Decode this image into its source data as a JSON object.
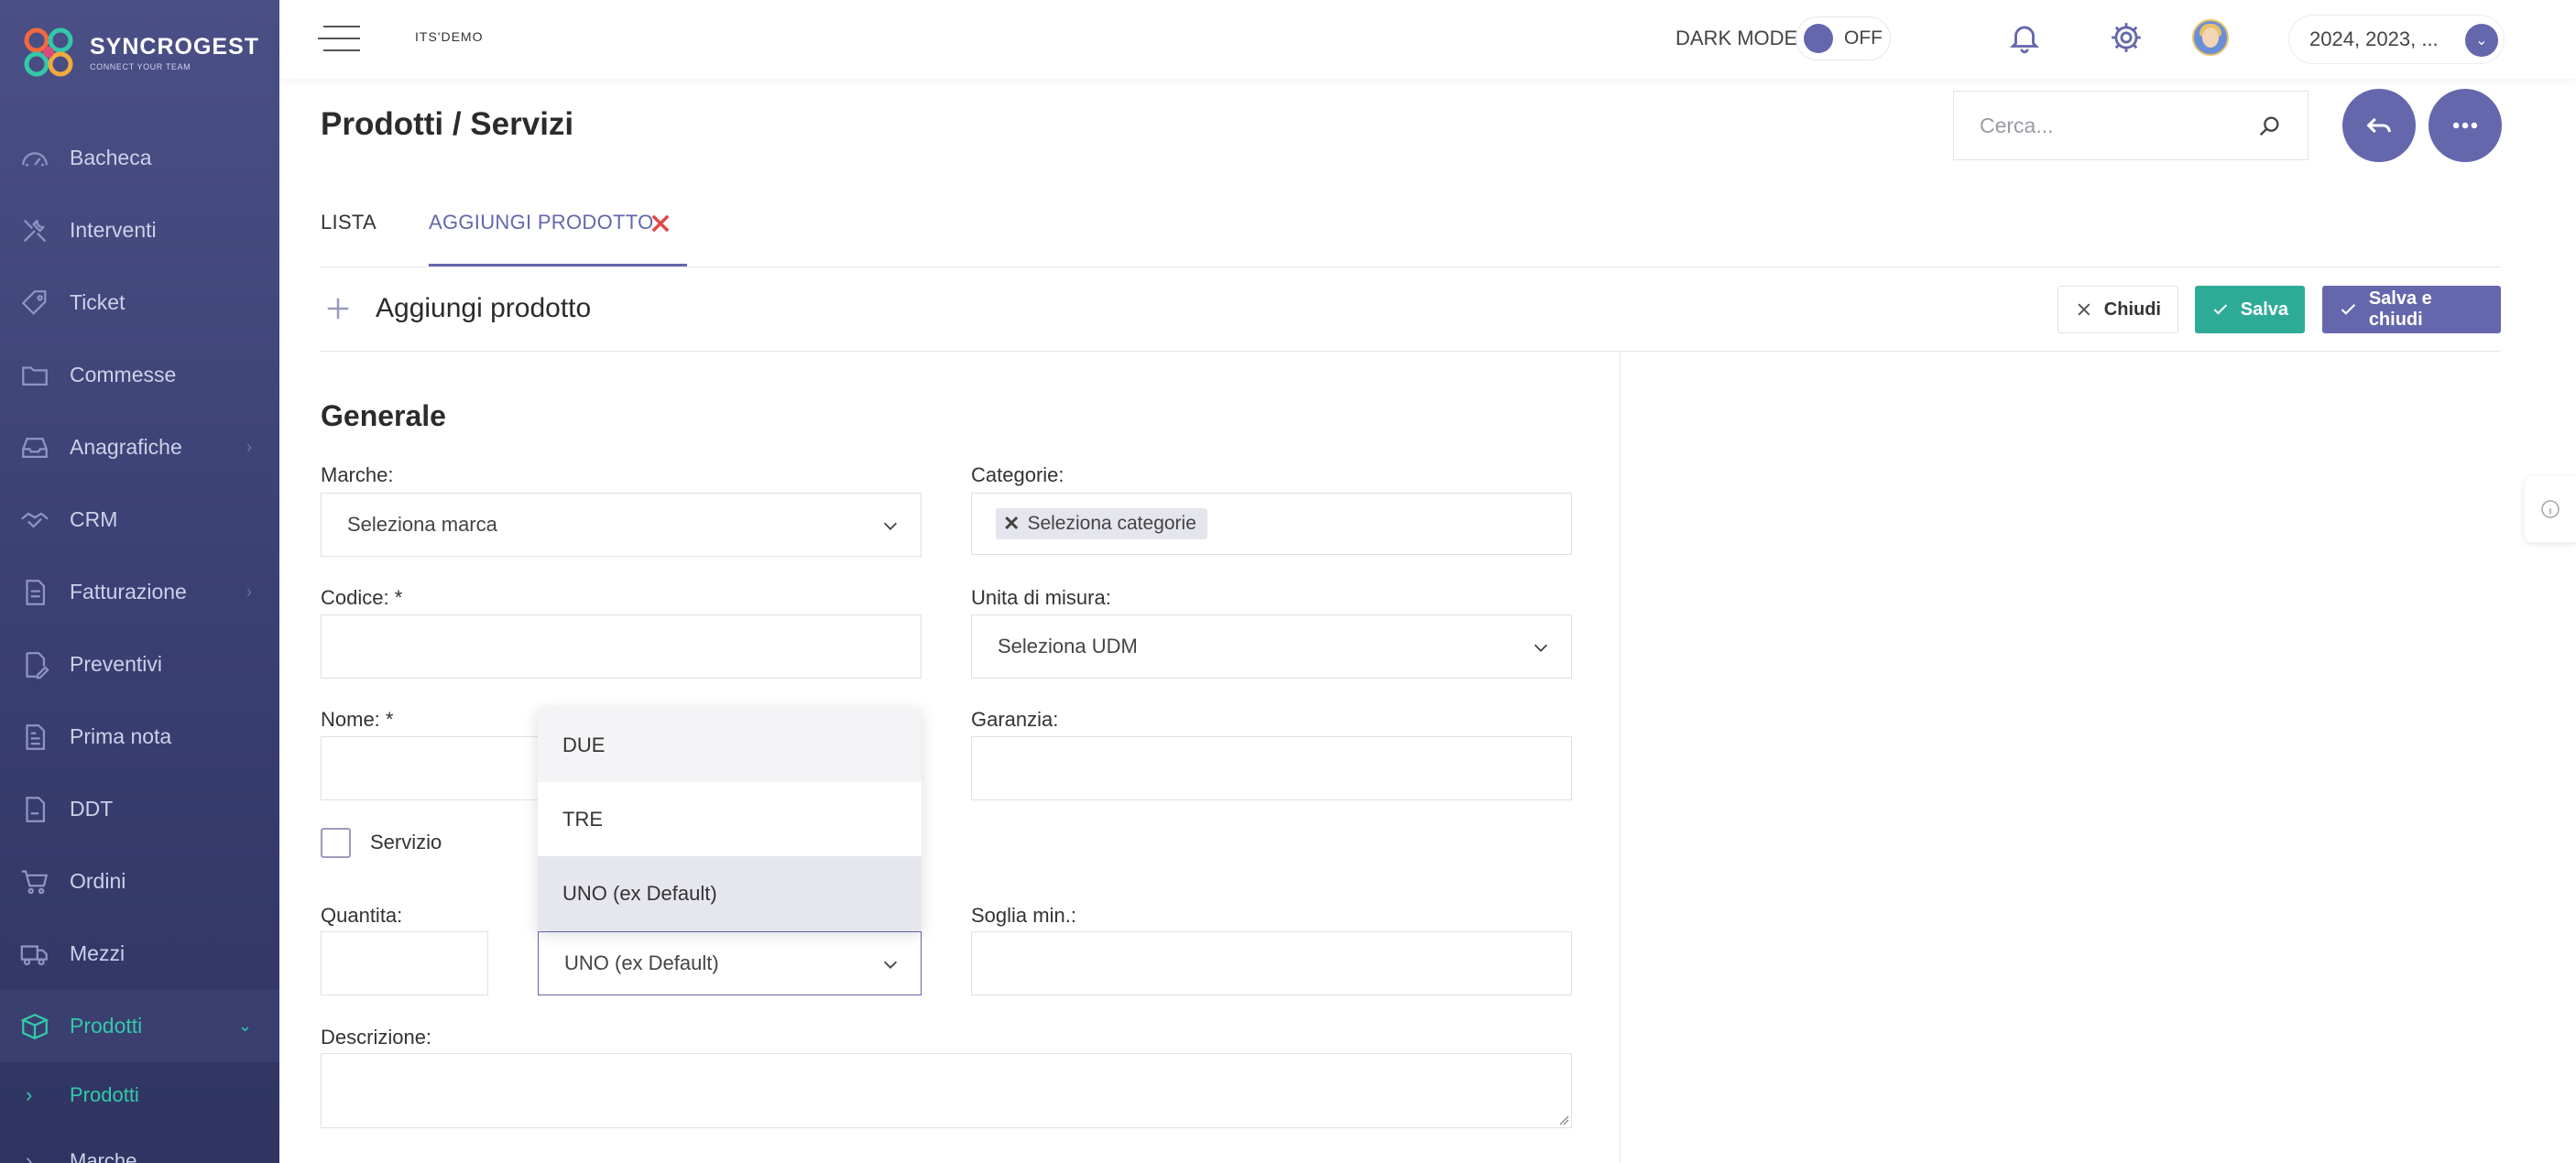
{
  "brand": {
    "name": "SYNCROGEST",
    "tagline": "CONNECT YOUR TEAM"
  },
  "sidebar": {
    "items": [
      {
        "label": "Bacheca",
        "icon": "dashboard-icon"
      },
      {
        "label": "Interventi",
        "icon": "tools-icon"
      },
      {
        "label": "Ticket",
        "icon": "ticket-icon"
      },
      {
        "label": "Commesse",
        "icon": "folder-icon"
      },
      {
        "label": "Anagrafiche",
        "icon": "inbox-icon",
        "chevron": "›"
      },
      {
        "label": "CRM",
        "icon": "handshake-icon"
      },
      {
        "label": "Fatturazione",
        "icon": "document-icon",
        "chevron": "›"
      },
      {
        "label": "Preventivi",
        "icon": "edit-document-icon"
      },
      {
        "label": "Prima nota",
        "icon": "notes-icon"
      },
      {
        "label": "DDT",
        "icon": "ddt-icon"
      },
      {
        "label": "Ordini",
        "icon": "cart-icon"
      },
      {
        "label": "Mezzi",
        "icon": "truck-icon"
      },
      {
        "label": "Prodotti",
        "icon": "box-icon",
        "chevron": "⌄",
        "active": true
      }
    ],
    "subitems": [
      {
        "label": "Prodotti",
        "active": true
      },
      {
        "label": "Marche"
      }
    ]
  },
  "topbar": {
    "company": "ITS'DEMO",
    "dark_mode_label": "DARK MODE",
    "dark_mode_state": "OFF",
    "years": "2024, 2023, ..."
  },
  "page": {
    "title": "Prodotti / Servizi",
    "search_placeholder": "Cerca..."
  },
  "tabs": {
    "list": "LISTA",
    "add": "AGGIUNGI PRODOTTO"
  },
  "section": {
    "title": "Aggiungi prodotto",
    "close_label": "Chiudi",
    "save_label": "Salva",
    "save_close_label": "Salva e chiudi"
  },
  "form": {
    "title": "Generale",
    "marche": {
      "label": "Marche:",
      "value": "Seleziona marca"
    },
    "categorie": {
      "label": "Categorie:",
      "tag": "Seleziona categorie"
    },
    "codice": {
      "label": "Codice: *",
      "value": ""
    },
    "udm": {
      "label": "Unita di misura:",
      "value": "Seleziona UDM"
    },
    "nome": {
      "label": "Nome: *",
      "value": ""
    },
    "garanzia": {
      "label": "Garanzia:",
      "value": ""
    },
    "servizio": {
      "label": "Servizio",
      "checked": false
    },
    "quantita": {
      "label": "Quantita:",
      "value": ""
    },
    "magazzino": {
      "value": "UNO (ex Default)"
    },
    "soglia": {
      "label": "Soglia min.:",
      "value": ""
    },
    "descrizione": {
      "label": "Descrizione:",
      "value": ""
    }
  },
  "dropdown": {
    "options": [
      "DUE",
      "TRE",
      "UNO (ex Default)"
    ],
    "hovered": "DUE",
    "selected": "UNO (ex Default)"
  },
  "colors": {
    "accent": "#6467ac",
    "success": "#2eab97",
    "sidebar": "#3a3f72",
    "active_nav": "#33c9a8",
    "danger": "#e04848"
  }
}
